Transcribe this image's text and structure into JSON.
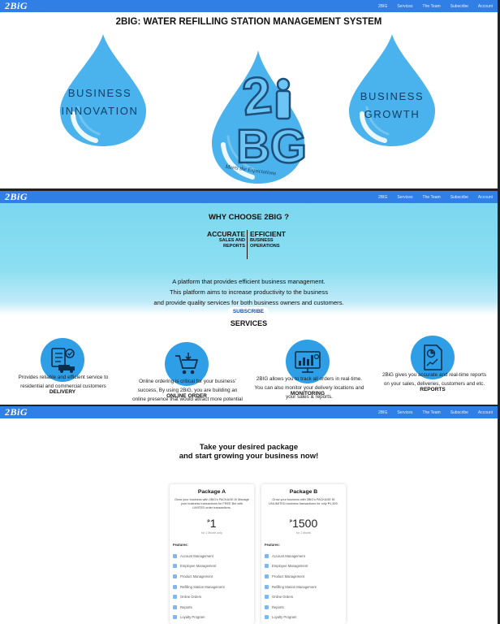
{
  "nav": {
    "logo": "2BiG",
    "links": [
      "2BIG",
      "Services",
      "The Team",
      "Subscribe",
      "Account"
    ]
  },
  "hero": {
    "title": "2BIG: WATER REFILLING STATION MANAGEMENT SYSTEM",
    "left_drop": [
      "BUSINESS",
      "INNOVATION"
    ],
    "right_drop": [
      "BUSINESS",
      "GROWTH"
    ],
    "center_logo_top": "2",
    "center_logo_bottom": "BG",
    "center_logo_i": "i",
    "tagline": "Meets the Expectations"
  },
  "why": {
    "title": "WHY CHOOSE 2BIG ?",
    "left_big": "ACCURATE",
    "left_small": [
      "SALES AND",
      "REPORTS"
    ],
    "right_big": "EFFICIENT",
    "right_small": [
      "BUSINESS",
      "OPERATIONS"
    ],
    "desc": [
      "A platform that provides efficient business management.",
      "This platform aims to increase productivity to the business",
      "and provide quality services for both business owners and customers."
    ],
    "subscribe": "SUBSCRIBE"
  },
  "services": {
    "title": "SERVICES",
    "items": [
      {
        "name": "DELIVERY",
        "icon": "delivery-checklist-icon",
        "desc": [
          "Provides reliable and efficient service to",
          "residential and commercial customers"
        ]
      },
      {
        "name": "ONLINE ORDER",
        "icon": "shopping-cart-icon",
        "desc": [
          "Online ordering is critical for your business'",
          "success, By using 2BiG, you are building an",
          "online presence that would attract more potential"
        ]
      },
      {
        "name": "MONITORING",
        "icon": "monitor-chart-icon",
        "desc": [
          "2BIG allows you to track all orders in real-time.",
          "You can also monitor your delivery locations and",
          "your sales & reports."
        ]
      },
      {
        "name": "REPORTS",
        "icon": "report-document-icon",
        "desc": [
          "2BiG gives you accurate and real-time reports",
          "on your sales, deliveries, customers and etc."
        ]
      }
    ]
  },
  "packages": {
    "title": [
      "Take your desired package",
      "and start growing your business now!"
    ],
    "features_label": "Features:",
    "items": [
      {
        "name": "Package A",
        "desc": "Grow your business with 2BiG's PACKAGE A! Manage your business transactions for FREE But with LIMITED order transactions.",
        "peso": "₱",
        "price": "1",
        "period": "for 1 Month only",
        "features": [
          "Account Management",
          "Employee Management",
          "Product Management",
          "Refilling Station Management",
          "Online Orders",
          "Reports",
          "Loyalty Program"
        ]
      },
      {
        "name": "Package B",
        "desc": "Grow your business with 2BiG's PACKAGE B! UNLIMITED business transactions for only ₱1,500.",
        "peso": "₱",
        "price": "1500",
        "period": "for 1 Month",
        "features": [
          "Account Management",
          "Employee Management",
          "Product Management",
          "Refilling Station Management",
          "Online Orders",
          "Reports",
          "Loyalty Program"
        ]
      }
    ]
  },
  "colors": {
    "nav": "#2f7fe6",
    "drop": "#4ab2ec",
    "why_bg": "#7ad7ef",
    "icon_circle": "#2e9ee6"
  }
}
